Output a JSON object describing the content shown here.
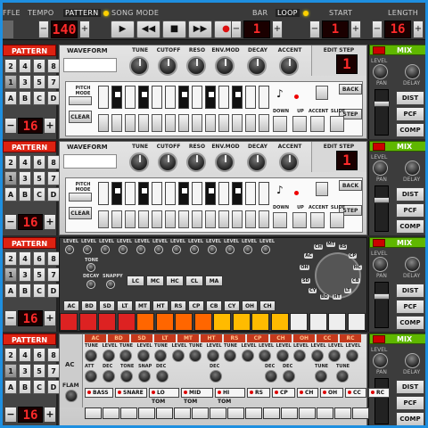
{
  "topbar": {
    "shuffle_label": "FFLE",
    "tempo_label": "TEMPO",
    "pattern_label": "PATTERN",
    "song_mode_label": "SONG MODE",
    "tempo_value": "140",
    "transport": [
      {
        "name": "play",
        "glyph": "▶"
      },
      {
        "name": "rewind",
        "glyph": "◀◀"
      },
      {
        "name": "stop",
        "glyph": "■"
      },
      {
        "name": "forward",
        "glyph": "▶▶"
      },
      {
        "name": "record",
        "glyph": "●"
      }
    ],
    "bar_label": "BAR",
    "loop_label": "LOOP",
    "start_label": "START",
    "length_label": "LENGTH",
    "bar_value": "1",
    "start_value": "1",
    "length_value": "16",
    "minus": "−",
    "plus": "+"
  },
  "pattern_panel": {
    "header": "PATTERN",
    "keys": [
      "2",
      "4",
      "6",
      "8",
      "1",
      "3",
      "5",
      "7",
      "A",
      "B",
      "C",
      "D"
    ],
    "minus": "−",
    "plus": "+",
    "value": "16"
  },
  "synth": {
    "waveform_label": "WAVEFORM",
    "knobs": [
      "TUNE",
      "CUTOFF",
      "RESO",
      "ENV.MOD",
      "DECAY",
      "ACCENT"
    ],
    "edit_step_label": "EDIT STEP",
    "edit_step_value": "1",
    "pitch_mode_label": "PITCH MODE",
    "clear_label": "CLEAR",
    "down_label": "DOWN",
    "up_label": "UP",
    "accent_label": "ACCENT",
    "slide_label": "SLIDE",
    "back_label": "BACK",
    "step_label": "STEP"
  },
  "mixer": {
    "header": "MIX",
    "level_label": "LEVEL",
    "pan_label": "PAN",
    "delay_label": "DELAY",
    "fx": [
      "DIST",
      "PCF",
      "COMP"
    ]
  },
  "drum1": {
    "top_labels": [
      "LEVEL",
      "LEVEL",
      "LEVEL",
      "LEVEL",
      "LEVEL",
      "LEVEL",
      "LEVEL",
      "LEVEL",
      "LEVEL",
      "LEVEL",
      "LEVEL",
      "LEVEL"
    ],
    "tone_label": "TONE",
    "decay_label": "DECAY",
    "snappy_label": "SNAPPY",
    "mid_buttons": [
      "LC",
      "MC",
      "HC",
      "CL",
      "MA"
    ],
    "instruments": [
      "AC",
      "BD",
      "SD",
      "LT",
      "MT",
      "HT",
      "RS",
      "CP",
      "CB",
      "CY",
      "OH",
      "CH"
    ],
    "selector": [
      "MT",
      "RS",
      "CP",
      "HC",
      "CB",
      "LT",
      "HT",
      "BD",
      "CY",
      "SD",
      "OH",
      "AC",
      "CH"
    ]
  },
  "drum2": {
    "heads": [
      "AC",
      "BD",
      "SD",
      "LT",
      "MT",
      "HT",
      "RS",
      "CP",
      "CH",
      "OH",
      "CC",
      "RC"
    ],
    "row_labels_top": [
      "TUNE",
      "LEVEL",
      "TUNE",
      "LEVEL",
      "TUNE",
      "LEVEL",
      "TUNE",
      "LEVEL",
      "TUNE",
      "LEVEL",
      "LEVEL",
      "LEVEL",
      "LEVEL",
      "LEVEL",
      "LEVEL",
      "LEVEL"
    ],
    "row_labels_mid": [
      "ATT",
      "DEC",
      "TONE",
      "SNAP",
      "DEC",
      "DEC",
      "DEC",
      "DEC",
      "TUNE",
      "TUNE"
    ],
    "ac_label": "AC",
    "flam_label": "FLAM",
    "instrument_buttons": [
      "BASS",
      "SNARE",
      "LO TOM",
      "MID TOM",
      "HI TOM",
      "RS",
      "CP",
      "CH",
      "OH",
      "CC",
      "RC"
    ]
  }
}
